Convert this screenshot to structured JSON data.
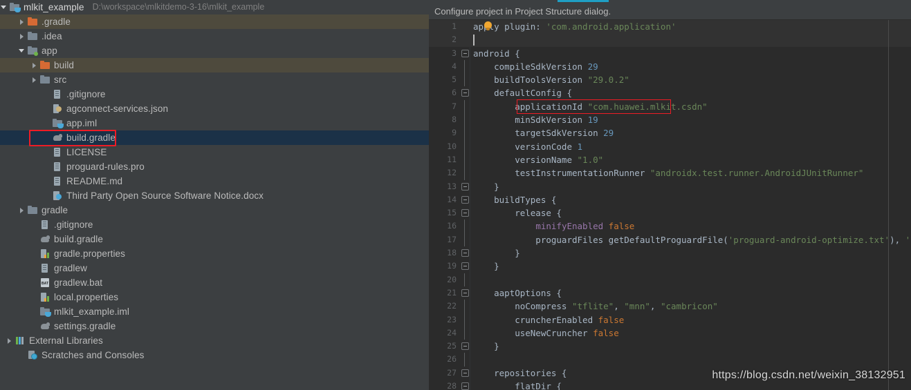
{
  "project": {
    "root": {
      "label": "mlkit_example",
      "path": "D:\\workspace\\mlkitdemo-3-16\\mlkit_example",
      "icon": "module-icon",
      "expanded": true
    },
    "tree": [
      {
        "label": ".gradle",
        "icon": "folder-orange-icon",
        "indent": 1,
        "arrow": "right",
        "state": "excluded"
      },
      {
        "label": ".idea",
        "icon": "folder-icon",
        "indent": 1,
        "arrow": "right",
        "state": "normal"
      },
      {
        "label": "app",
        "icon": "module-icon",
        "indent": 1,
        "arrow": "down",
        "state": "normal"
      },
      {
        "label": "build",
        "icon": "folder-orange-icon",
        "indent": 2,
        "arrow": "right",
        "state": "excluded"
      },
      {
        "label": "src",
        "icon": "folder-icon",
        "indent": 2,
        "arrow": "right",
        "state": "normal"
      },
      {
        "label": ".gitignore",
        "icon": "file-icon",
        "indent": 3,
        "arrow": "none",
        "state": "normal"
      },
      {
        "label": "agconnect-services.json",
        "icon": "json-icon",
        "indent": 3,
        "arrow": "none",
        "state": "normal"
      },
      {
        "label": "app.iml",
        "icon": "module-icon",
        "indent": 3,
        "arrow": "none",
        "state": "normal"
      },
      {
        "label": "build.gradle",
        "icon": "gradle-icon",
        "indent": 3,
        "arrow": "none",
        "state": "selected"
      },
      {
        "label": "LICENSE",
        "icon": "file-icon",
        "indent": 3,
        "arrow": "none",
        "state": "normal"
      },
      {
        "label": "proguard-rules.pro",
        "icon": "file-icon",
        "indent": 3,
        "arrow": "none",
        "state": "normal"
      },
      {
        "label": "README.md",
        "icon": "file-icon",
        "indent": 3,
        "arrow": "none",
        "state": "normal"
      },
      {
        "label": "Third Party Open Source Software Notice.docx",
        "icon": "docx-icon",
        "indent": 3,
        "arrow": "none",
        "state": "normal"
      },
      {
        "label": "gradle",
        "icon": "folder-icon",
        "indent": 1,
        "arrow": "right",
        "state": "normal"
      },
      {
        "label": ".gitignore",
        "icon": "file-icon",
        "indent": 2,
        "arrow": "none",
        "state": "normal"
      },
      {
        "label": "build.gradle",
        "icon": "gradle-icon",
        "indent": 2,
        "arrow": "none",
        "state": "normal"
      },
      {
        "label": "gradle.properties",
        "icon": "properties-icon",
        "indent": 2,
        "arrow": "none",
        "state": "normal"
      },
      {
        "label": "gradlew",
        "icon": "file-icon",
        "indent": 2,
        "arrow": "none",
        "state": "normal"
      },
      {
        "label": "gradlew.bat",
        "icon": "bat-icon",
        "indent": 2,
        "arrow": "none",
        "state": "normal"
      },
      {
        "label": "local.properties",
        "icon": "properties-icon",
        "indent": 2,
        "arrow": "none",
        "state": "normal"
      },
      {
        "label": "mlkit_example.iml",
        "icon": "module-icon",
        "indent": 2,
        "arrow": "none",
        "state": "normal"
      },
      {
        "label": "settings.gradle",
        "icon": "gradle-icon",
        "indent": 2,
        "arrow": "none",
        "state": "normal"
      },
      {
        "label": "External Libraries",
        "icon": "libraries-icon",
        "indent": 0,
        "arrow": "right",
        "state": "normal"
      },
      {
        "label": "Scratches and Consoles",
        "icon": "scratches-icon",
        "indent": 1,
        "arrow": "none",
        "state": "normal"
      }
    ]
  },
  "editor": {
    "notification": "Configure project in Project Structure dialog.",
    "bulb_icon": "lightbulb-icon",
    "tab_accent_color": "#1f9fc4",
    "selection_color": "#1b3147",
    "excluded_color": "#4e4a3d",
    "highlight_box_color": "#ee1c25",
    "lines": [
      {
        "n": 1,
        "fold": "none",
        "current": true,
        "tokens": [
          {
            "t": "apply plugin: ",
            "c": "def"
          },
          {
            "t": "'com.android.application'",
            "c": "str"
          }
        ]
      },
      {
        "n": 2,
        "fold": "none",
        "current": true,
        "tokens": []
      },
      {
        "n": 3,
        "fold": "start",
        "current": false,
        "tokens": [
          {
            "t": "android {",
            "c": "def"
          }
        ]
      },
      {
        "n": 4,
        "fold": "line",
        "current": false,
        "tokens": [
          {
            "t": "    compileSdkVersion ",
            "c": "def"
          },
          {
            "t": "29",
            "c": "num"
          }
        ]
      },
      {
        "n": 5,
        "fold": "line",
        "current": false,
        "tokens": [
          {
            "t": "    buildToolsVersion ",
            "c": "def"
          },
          {
            "t": "\"29.0.2\"",
            "c": "str"
          }
        ]
      },
      {
        "n": 6,
        "fold": "start2",
        "current": false,
        "tokens": [
          {
            "t": "    defaultConfig {",
            "c": "def"
          }
        ]
      },
      {
        "n": 7,
        "fold": "line2",
        "current": false,
        "tokens": [
          {
            "t": "        applicationId ",
            "c": "def"
          },
          {
            "t": "\"com.huawei.mlkit.csdn\"",
            "c": "str"
          }
        ]
      },
      {
        "n": 8,
        "fold": "line2",
        "current": false,
        "tokens": [
          {
            "t": "        minSdkVersion ",
            "c": "def"
          },
          {
            "t": "19",
            "c": "num"
          }
        ]
      },
      {
        "n": 9,
        "fold": "line2",
        "current": false,
        "tokens": [
          {
            "t": "        targetSdkVersion ",
            "c": "def"
          },
          {
            "t": "29",
            "c": "num"
          }
        ]
      },
      {
        "n": 10,
        "fold": "line2",
        "current": false,
        "tokens": [
          {
            "t": "        versionCode ",
            "c": "def"
          },
          {
            "t": "1",
            "c": "num"
          }
        ]
      },
      {
        "n": 11,
        "fold": "line2",
        "current": false,
        "tokens": [
          {
            "t": "        versionName ",
            "c": "def"
          },
          {
            "t": "\"1.0\"",
            "c": "str"
          }
        ]
      },
      {
        "n": 12,
        "fold": "line2",
        "current": false,
        "tokens": [
          {
            "t": "        testInstrumentationRunner ",
            "c": "def"
          },
          {
            "t": "\"androidx.test.runner.AndroidJUnitRunner\"",
            "c": "str"
          }
        ]
      },
      {
        "n": 13,
        "fold": "end2",
        "current": false,
        "tokens": [
          {
            "t": "    }",
            "c": "def"
          }
        ]
      },
      {
        "n": 14,
        "fold": "start2",
        "current": false,
        "tokens": [
          {
            "t": "    buildTypes {",
            "c": "def"
          }
        ]
      },
      {
        "n": 15,
        "fold": "start3",
        "current": false,
        "tokens": [
          {
            "t": "        release {",
            "c": "def"
          }
        ]
      },
      {
        "n": 16,
        "fold": "line3",
        "current": false,
        "tokens": [
          {
            "t": "            ",
            "c": "def"
          },
          {
            "t": "minifyEnabled ",
            "c": "fld"
          },
          {
            "t": "false",
            "c": "kw"
          }
        ]
      },
      {
        "n": 17,
        "fold": "line3",
        "current": false,
        "tokens": [
          {
            "t": "            proguardFiles getDefaultProguardFile(",
            "c": "def"
          },
          {
            "t": "'proguard-android-optimize.txt'",
            "c": "str"
          },
          {
            "t": "), ",
            "c": "def"
          },
          {
            "t": "'proguard-rules.pro'",
            "c": "str"
          }
        ]
      },
      {
        "n": 18,
        "fold": "end3",
        "current": false,
        "tokens": [
          {
            "t": "        }",
            "c": "def"
          }
        ]
      },
      {
        "n": 19,
        "fold": "end2",
        "current": false,
        "tokens": [
          {
            "t": "    }",
            "c": "def"
          }
        ]
      },
      {
        "n": 20,
        "fold": "line",
        "current": false,
        "tokens": []
      },
      {
        "n": 21,
        "fold": "start2",
        "current": false,
        "tokens": [
          {
            "t": "    aaptOptions {",
            "c": "def"
          }
        ]
      },
      {
        "n": 22,
        "fold": "line2",
        "current": false,
        "tokens": [
          {
            "t": "        noCompress ",
            "c": "def"
          },
          {
            "t": "\"tflite\"",
            "c": "str"
          },
          {
            "t": ", ",
            "c": "def"
          },
          {
            "t": "\"mnn\"",
            "c": "str"
          },
          {
            "t": ", ",
            "c": "def"
          },
          {
            "t": "\"cambricon\"",
            "c": "str"
          }
        ]
      },
      {
        "n": 23,
        "fold": "line2",
        "current": false,
        "tokens": [
          {
            "t": "        cruncherEnabled ",
            "c": "def"
          },
          {
            "t": "false",
            "c": "kw"
          }
        ]
      },
      {
        "n": 24,
        "fold": "line2",
        "current": false,
        "tokens": [
          {
            "t": "        useNewCruncher ",
            "c": "def"
          },
          {
            "t": "false",
            "c": "kw"
          }
        ]
      },
      {
        "n": 25,
        "fold": "end2",
        "current": false,
        "tokens": [
          {
            "t": "    }",
            "c": "def"
          }
        ]
      },
      {
        "n": 26,
        "fold": "line",
        "current": false,
        "tokens": []
      },
      {
        "n": 27,
        "fold": "start2",
        "current": false,
        "tokens": [
          {
            "t": "    repositories {",
            "c": "def"
          }
        ]
      },
      {
        "n": 28,
        "fold": "start3",
        "current": false,
        "tokens": [
          {
            "t": "        flatDir {",
            "c": "def"
          }
        ]
      }
    ]
  },
  "watermark": {
    "text": "https://blog.csdn.net/weixin_38132951"
  }
}
